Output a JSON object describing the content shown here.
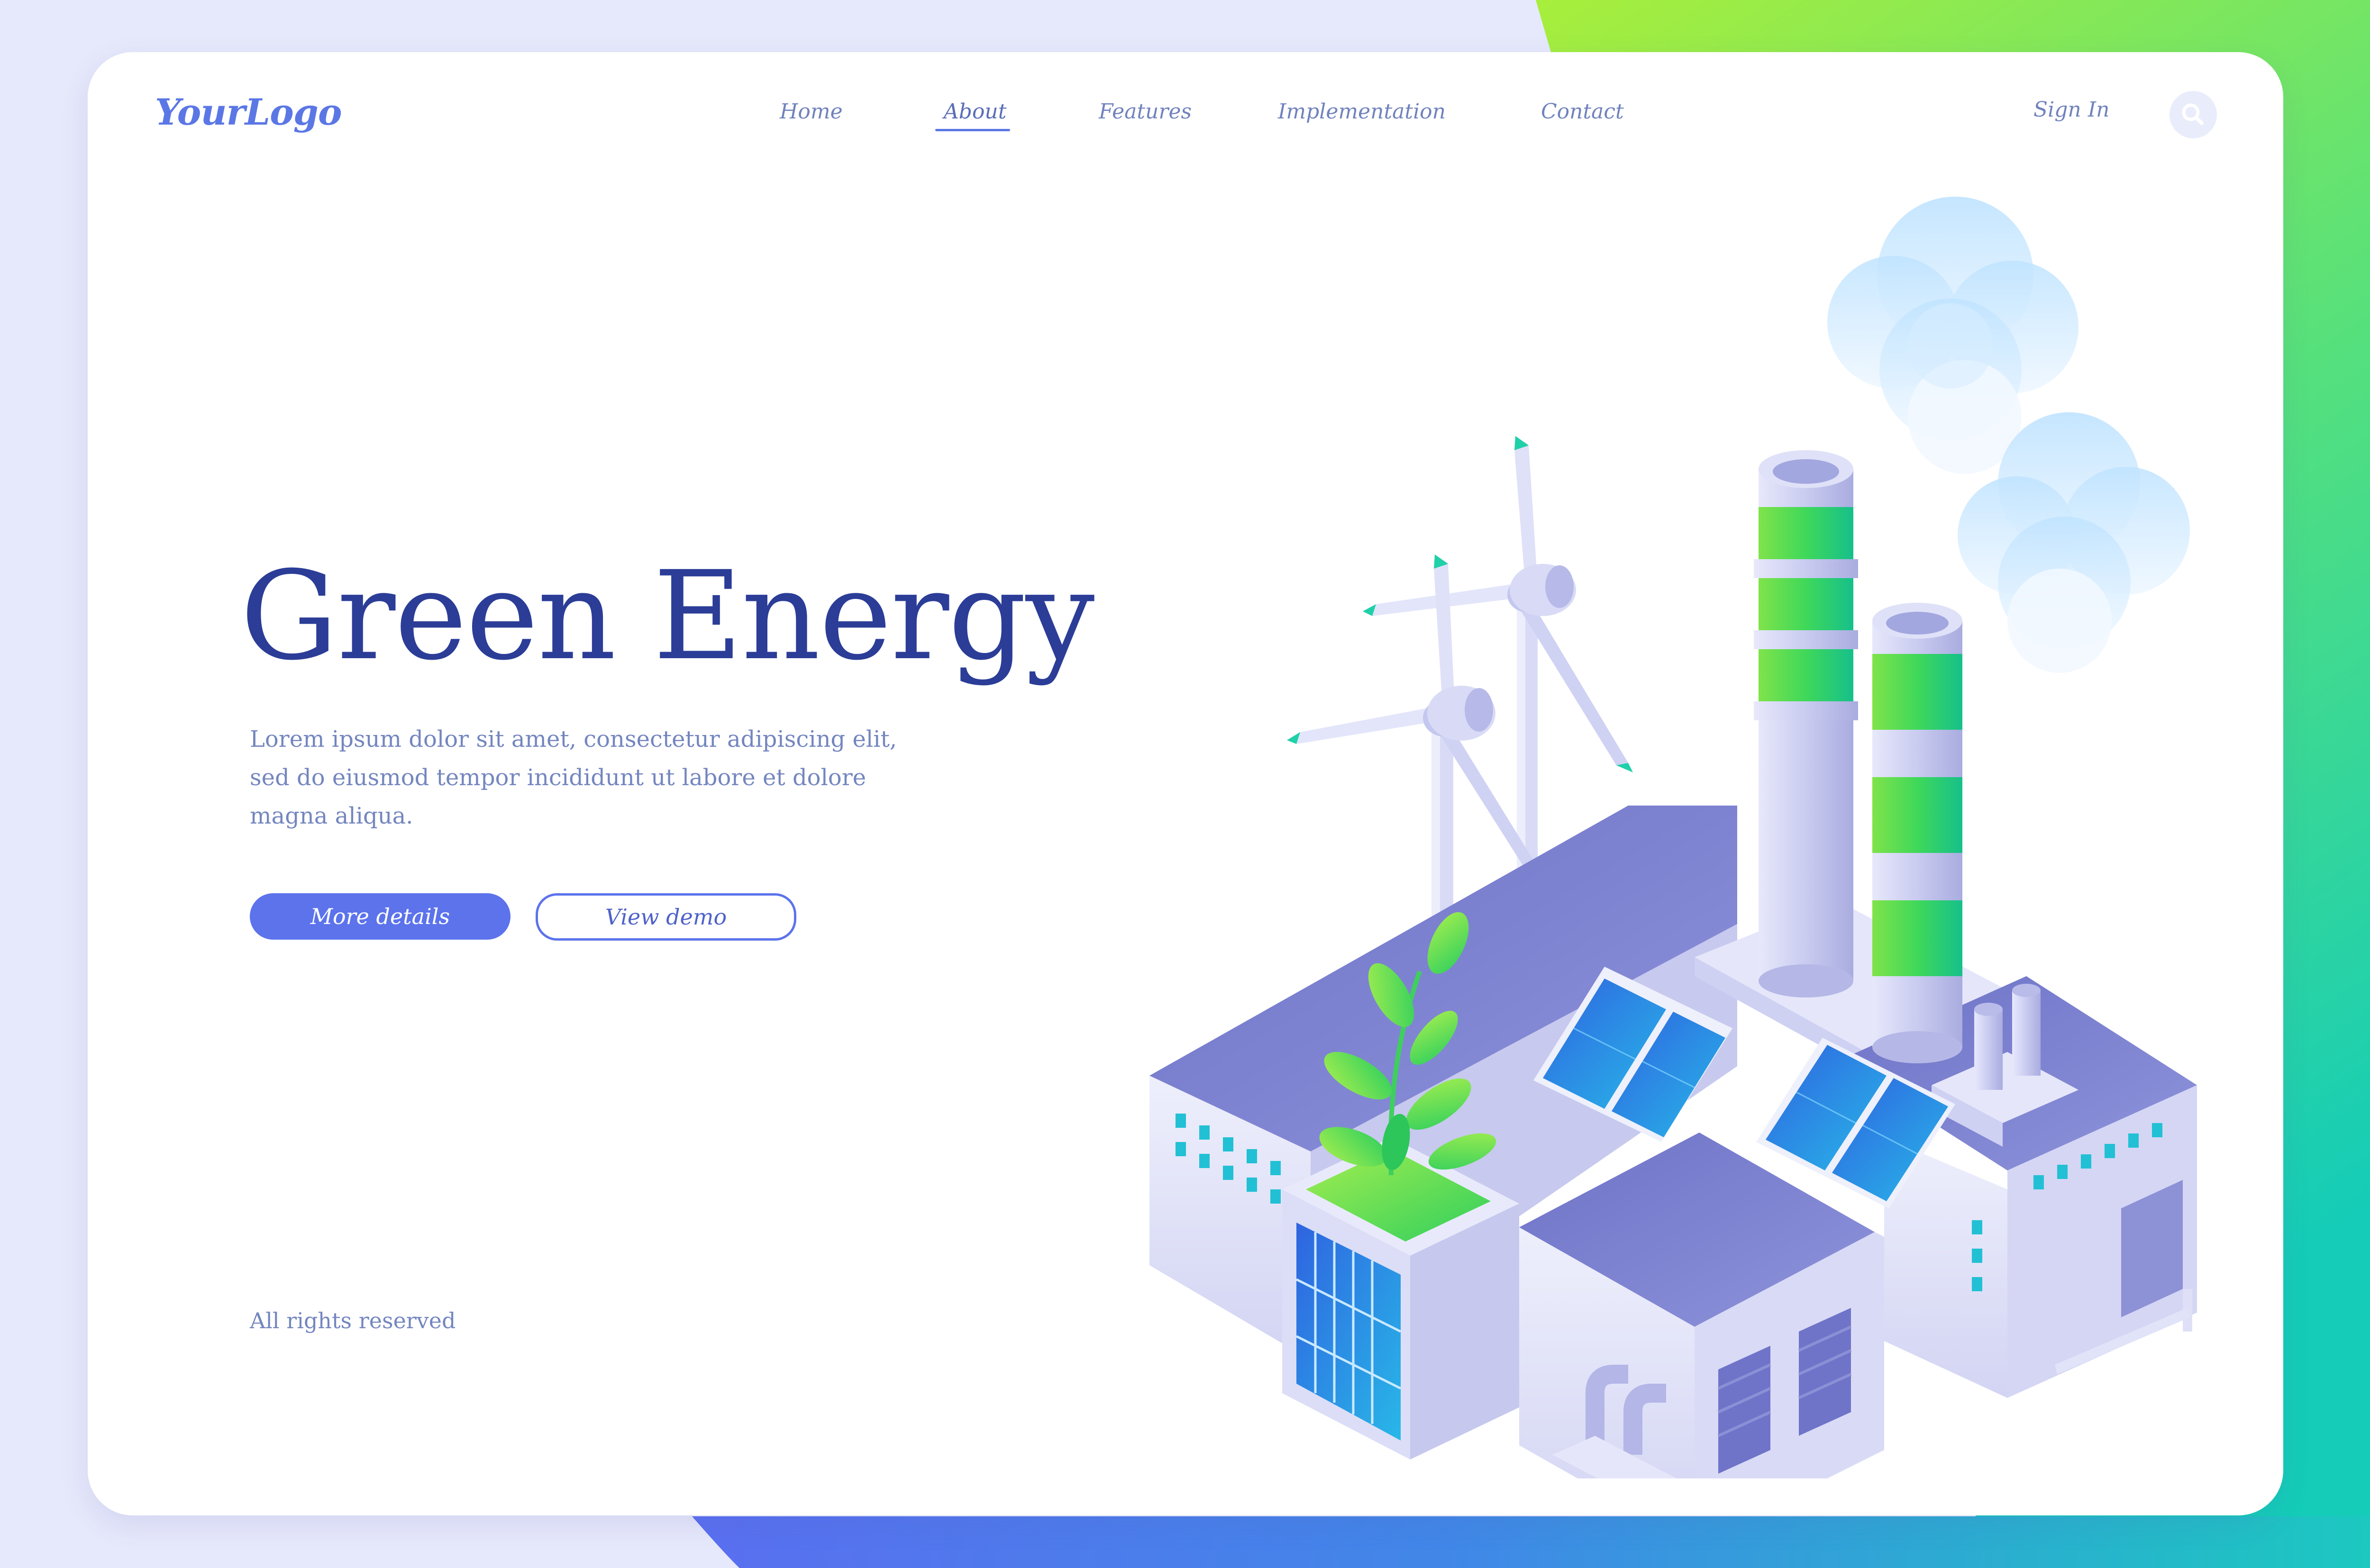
{
  "brand": {
    "logo_text": "YourLogo"
  },
  "nav": {
    "items": [
      {
        "label": "Home"
      },
      {
        "label": "About"
      },
      {
        "label": "Features"
      },
      {
        "label": "Implementation"
      },
      {
        "label": "Contact"
      }
    ],
    "active_item": "About",
    "sign_in_label": "Sign In",
    "search_icon": "search-icon"
  },
  "hero": {
    "title": "Green Energy",
    "description": "Lorem ipsum dolor sit amet, consectetur adipiscing elit, sed do eiusmod tempor incididunt ut labore et dolore magna aliqua.",
    "primary_button_label": "More details",
    "secondary_button_label": "View demo"
  },
  "footer": {
    "copyright": "All rights reserved"
  },
  "colors": {
    "accent": "#5c73ec",
    "title": "#2b3d97",
    "body_text": "#7486bf",
    "gradient_green": "#a7f03a",
    "gradient_teal": "#1bcfb4"
  }
}
